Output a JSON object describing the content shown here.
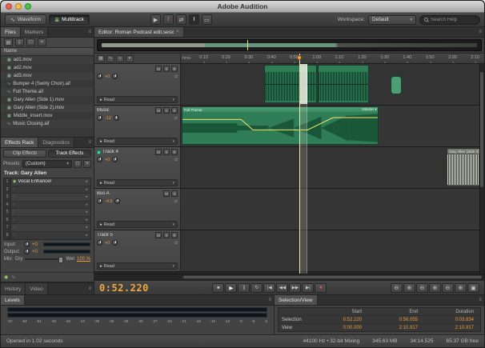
{
  "window": {
    "title": "Adobe Audition"
  },
  "toolbar": {
    "waveform": "Waveform",
    "multitrack": "Multitrack",
    "workspace_label": "Workspace:",
    "workspace_value": "Default",
    "search_placeholder": "Search Help",
    "tools": [
      "▶",
      "/",
      "⇄",
      "I",
      "▭"
    ]
  },
  "icons": {
    "waveform": "∿",
    "multitrack": "≣",
    "dropdown": "▾",
    "panel_menu": "≡",
    "close": "×",
    "chevron": "▸",
    "io_arrows": "⇄",
    "files_toolbar": [
      "▤",
      "⇩",
      "□",
      "×"
    ],
    "preset_actions": [
      "□",
      "×"
    ],
    "slot_power_on": "◉",
    "slot_power_off": "○",
    "fx_bottom": [
      "◉",
      "∿"
    ],
    "hdr_tools": [
      "▦",
      "∿",
      "≡",
      "▾"
    ]
  },
  "files": {
    "tab_files": "Files",
    "tab_markers": "Markers",
    "name_header": "Name",
    "items": [
      {
        "icon": "▦",
        "name": "ad1.mov"
      },
      {
        "icon": "▦",
        "name": "ad2.mov"
      },
      {
        "icon": "▦",
        "name": "ad3.mov"
      },
      {
        "icon": "∿",
        "name": "Bumper 4 (Swirly Choir).aif"
      },
      {
        "icon": "∿",
        "name": "Full Theme.aif"
      },
      {
        "icon": "▦",
        "name": "Gary Allen (Side 1).mov"
      },
      {
        "icon": "▦",
        "name": "Gary Allen (Side 2).mov"
      },
      {
        "icon": "▦",
        "name": "Middle_insert.mov"
      },
      {
        "icon": "∿",
        "name": "Music Closing.aif"
      }
    ]
  },
  "effects": {
    "tab_rack": "Effects Rack",
    "tab_diag": "Diagnostics",
    "clip_effects": "Clip Effects",
    "track_effects": "Track Effects",
    "presets_label": "Presets:",
    "presets_value": "(Custom)",
    "track_label": "Track: Gary Allen",
    "slots": [
      {
        "num": "1",
        "name": "Vocal Enhancer"
      },
      {
        "num": "2",
        "name": ""
      },
      {
        "num": "3",
        "name": ""
      },
      {
        "num": "4",
        "name": ""
      },
      {
        "num": "5",
        "name": ""
      },
      {
        "num": "6",
        "name": ""
      },
      {
        "num": "7",
        "name": ""
      },
      {
        "num": "8",
        "name": ""
      }
    ],
    "input_label": "Input:",
    "input_value": "+0",
    "output_label": "Output:",
    "output_value": "+0",
    "mix_label": "Mix:",
    "dry_label": "Dry",
    "wet_label": "Wet",
    "wet_value": "100 %"
  },
  "history": {
    "tab_history": "History",
    "tab_video": "Video"
  },
  "editor": {
    "tab_label": "Editor: Roman Podcast edit.sesx",
    "ruler": {
      "timebase": "hms",
      "ticks": [
        "0:10",
        "0:20",
        "0:30",
        "0:40",
        "0:50",
        "1:00",
        "1:10",
        "1:20",
        "1:30",
        "1:40",
        "1:50",
        "2:00",
        "2:10"
      ]
    },
    "track_buttons": {
      "mute": "M",
      "solo": "S",
      "arm": "R"
    },
    "automation_mode": "Read",
    "tracks": [
      {
        "name": "",
        "vol": "+0"
      },
      {
        "name": "Music",
        "vol": "-12"
      },
      {
        "name": "Track 4",
        "vol": "+0"
      },
      {
        "name": "Bus A",
        "vol": "-4.5"
      },
      {
        "name": "Track 5",
        "vol": "+0"
      }
    ],
    "clips": {
      "full_theme": "Full Theme",
      "volume_label": "Volume",
      "gary_side2": "Gary Allen (Side 2)"
    }
  },
  "transport": {
    "time": "0:52.220",
    "icons": {
      "stop": "■",
      "play": "▶",
      "pause": "∥",
      "loop": "↻",
      "skip_back": "|◀",
      "rewind": "◀◀",
      "forward": "▶▶",
      "skip_fwd": "▶|",
      "record": "●"
    },
    "zoom": [
      "⊖",
      "⊕",
      "⊖",
      "⊕",
      "⊖",
      "⊕",
      "▣"
    ]
  },
  "levels": {
    "title": "Levels",
    "scale": [
      "-57",
      "-54",
      "-51",
      "-48",
      "-45",
      "-42",
      "-39",
      "-36",
      "-33",
      "-30",
      "-27",
      "-24",
      "-21",
      "-18",
      "-15",
      "-12",
      "-9",
      "-6",
      "-3"
    ]
  },
  "selection_view": {
    "title": "Selection/View",
    "col_start": "Start",
    "col_end": "End",
    "col_duration": "Duration",
    "row_selection_label": "Selection",
    "row_view_label": "View",
    "selection": {
      "start": "0:52.220",
      "end": "0:56.055",
      "duration": "0:03.834"
    },
    "view": {
      "start": "0:00.000",
      "end": "2:10.917",
      "duration": "2:10.917"
    }
  },
  "status": {
    "left": "Opened in 1.02 seconds",
    "format": "44100 Hz • 32-bit Mixing",
    "size": "345.63 MB",
    "duration": "34:14.525",
    "free": "65.37 GB free"
  },
  "colors": {
    "accent_orange": "#f2a93b",
    "clip_green": "#2f7d57",
    "selection_highlight": "#f5f0dc"
  }
}
